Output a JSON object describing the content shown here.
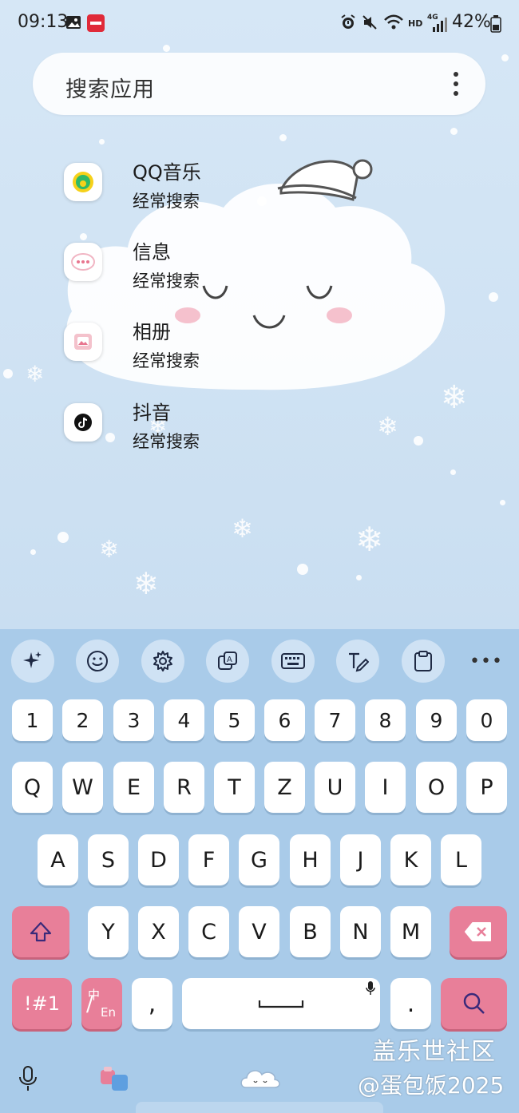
{
  "status_bar": {
    "time": "09:13",
    "battery": "42%",
    "network": "4G",
    "hd": "HD"
  },
  "search": {
    "placeholder": "搜索应用"
  },
  "apps": [
    {
      "name": "QQ音乐",
      "subtitle": "经常搜索",
      "icon": "qq-music-icon"
    },
    {
      "name": "信息",
      "subtitle": "经常搜索",
      "icon": "messages-icon"
    },
    {
      "name": "相册",
      "subtitle": "经常搜索",
      "icon": "gallery-icon"
    },
    {
      "name": "抖音",
      "subtitle": "经常搜索",
      "icon": "douyin-icon"
    }
  ],
  "keyboard": {
    "number_row": [
      "1",
      "2",
      "3",
      "4",
      "5",
      "6",
      "7",
      "8",
      "9",
      "0"
    ],
    "row1": [
      "Q",
      "W",
      "E",
      "R",
      "T",
      "Z",
      "U",
      "I",
      "O",
      "P"
    ],
    "row2": [
      "A",
      "S",
      "D",
      "F",
      "G",
      "H",
      "J",
      "K",
      "L"
    ],
    "row3": [
      "Y",
      "X",
      "C",
      "V",
      "B",
      "N",
      "M"
    ],
    "symbols_label": "!#1",
    "lang_top": "中",
    "lang_bottom": "En",
    "comma": ",",
    "period": ".",
    "colors": {
      "background": "#a9cbe9",
      "key": "#ffffff",
      "accent": "#e87f99"
    }
  },
  "watermark": {
    "line1": "盖乐世社区",
    "line2": "@蛋包饭2025"
  }
}
